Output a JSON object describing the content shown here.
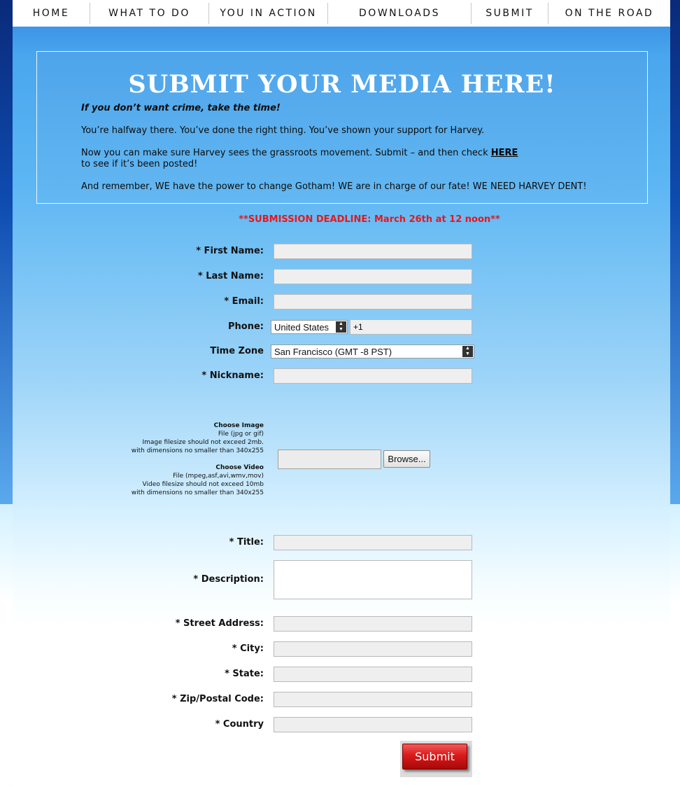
{
  "nav": {
    "items": [
      "HOME",
      "WHAT TO DO",
      "YOU IN ACTION",
      "DOWNLOADS",
      "SUBMIT",
      "ON THE ROAD"
    ]
  },
  "intro": {
    "heading": "SUBMIT YOUR MEDIA HERE!",
    "tagline": "If you don’t want crime, take the time!",
    "p1": "You’re halfway there. You’ve done the right thing. You’ve shown your support for Harvey.",
    "p2_before": "Now you can make sure Harvey sees the grassroots movement. Submit – and then check ",
    "p2_link": "HERE",
    "p2_after": "to see if it’s been posted!",
    "p3": "And remember, WE have the power to change Gotham! WE are in charge of our fate! WE NEED HARVEY DENT!"
  },
  "deadline": "**SUBMISSION DEADLINE: March 26th at 12 noon**",
  "form": {
    "first_name_label": "* First Name:",
    "last_name_label": "* Last Name:",
    "email_label": "* Email:",
    "phone_label": "Phone:",
    "phone_country": "United States",
    "phone_value": "+1",
    "timezone_label": "Time Zone",
    "timezone_value": "San Francisco (GMT -8 PST)",
    "nickname_label": "* Nickname:",
    "image_title": "Choose Image",
    "image_line1": "File (jpg or gif)",
    "image_line2": "Image filesize should not exceed 2mb.",
    "image_line3": "with dimensions no smaller than 340x255",
    "video_title": "Choose Video",
    "video_line1": "File (mpeg,asf,avi,wmv,mov)",
    "video_line2": "Video filesize should not exceed 10mb",
    "video_line3": "with dimensions no smaller than 340x255",
    "browse_label": "Browse...",
    "title_label": "* Title:",
    "description_label": "* Description:",
    "street_label": "* Street Address:",
    "city_label": "* City:",
    "state_label": "* State:",
    "zip_label": "* Zip/Postal Code:",
    "country_label": "* Country",
    "submit_label": "Submit"
  }
}
